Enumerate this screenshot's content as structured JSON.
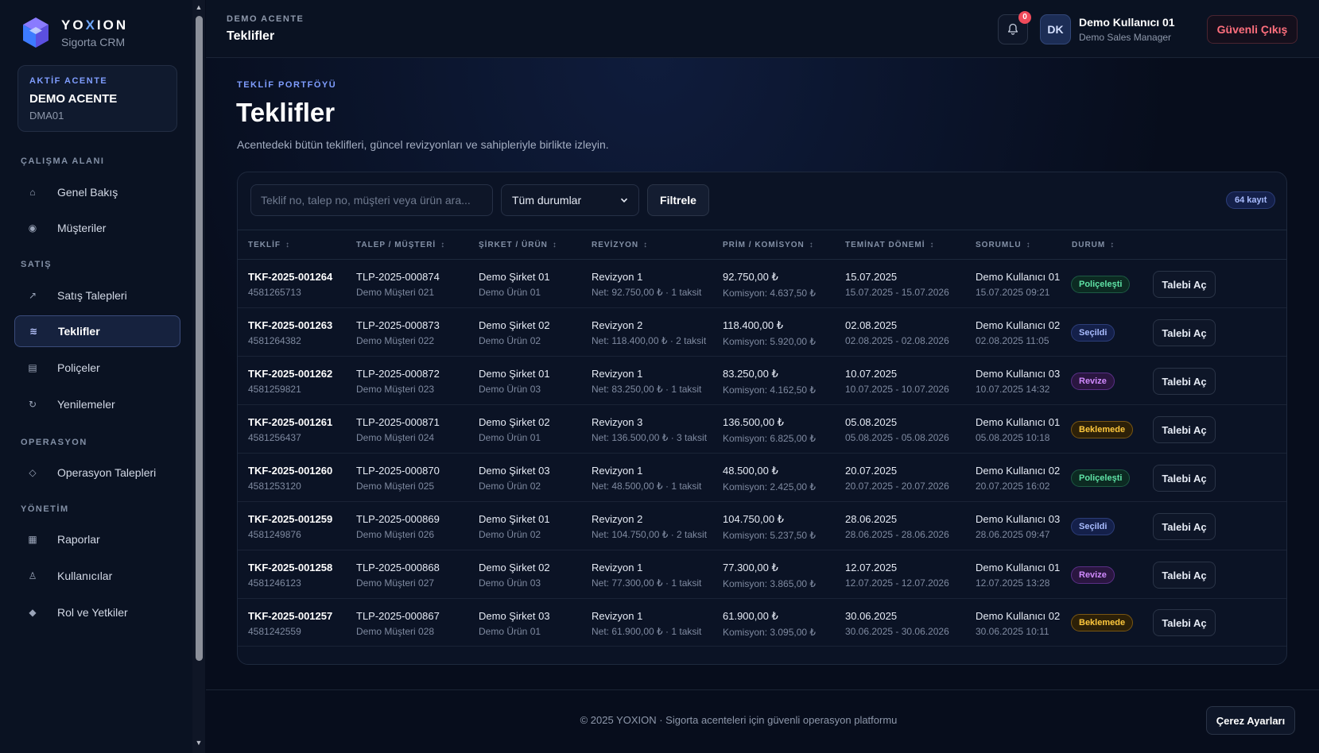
{
  "brand": {
    "name_pre": "YO",
    "name_x": "X",
    "name_post": "ION",
    "subtitle": "Sigorta CRM"
  },
  "agency": {
    "kicker": "AKTİF ACENTE",
    "name": "DEMO ACENTE",
    "code": "DMA01"
  },
  "nav": {
    "section_workspace": "ÇALIŞMA ALANI",
    "section_sales": "SATIŞ",
    "section_operations": "OPERASYON",
    "section_management": "YÖNETİM",
    "items": [
      {
        "label": "Genel Bakış",
        "icon": "home-icon"
      },
      {
        "label": "Müşteriler",
        "icon": "users-icon"
      },
      {
        "label": "Satış Talepleri",
        "icon": "trend-arrow-icon"
      },
      {
        "label": "Teklifler",
        "icon": "offers-icon"
      },
      {
        "label": "Poliçeler",
        "icon": "document-icon"
      },
      {
        "label": "Yenilemeler",
        "icon": "refresh-icon"
      },
      {
        "label": "Operasyon Talepleri",
        "icon": "diamond-icon"
      },
      {
        "label": "Raporlar",
        "icon": "report-icon"
      },
      {
        "label": "Kullanıcılar",
        "icon": "user-icon"
      },
      {
        "label": "Rol ve Yetkiler",
        "icon": "shield-icon"
      }
    ]
  },
  "topbar": {
    "kicker": "DEMO ACENTE",
    "title": "Teklifler",
    "notification_count": "0",
    "avatar_initials": "DK",
    "user_name": "Demo Kullanıcı 01",
    "user_role": "Demo Sales Manager",
    "logout_label": "Güvenli Çıkış"
  },
  "page": {
    "kicker": "TEKLİF PORTFÖYÜ",
    "title": "Teklifler",
    "description": "Acentedeki bütün teklifleri, güncel revizyonları ve sahipleriyle birlikte izleyin."
  },
  "filters": {
    "search_placeholder": "Teklif no, talep no, müşteri veya ürün ara...",
    "status_selected": "Tüm durumlar",
    "filter_label": "Filtrele",
    "record_count": "64 kayıt"
  },
  "table": {
    "headers": [
      "TEKLİF",
      "TALEP / MÜŞTERİ",
      "ŞİRKET / ÜRÜN",
      "REVİZYON",
      "PRİM / KOMİSYON",
      "TEMİNAT DÖNEMİ",
      "SORUMLU",
      "DURUM"
    ],
    "action_label": "Talebi Aç",
    "rows": [
      {
        "offer": "TKF-2025-001264",
        "offer_sub": "4581265713",
        "request": "TLP-2025-000874",
        "customer": "Demo Müşteri 021",
        "company": "Demo Şirket 01",
        "product": "Demo Ürün 01",
        "revision": "Revizyon 1",
        "revision_sub": "Net: 92.750,00 ₺ · 1 taksit",
        "premium": "92.750,00 ₺",
        "commission": "Komisyon: 4.637,50 ₺",
        "coverage_start": "15.07.2025",
        "coverage_range": "15.07.2025 - 15.07.2026",
        "owner": "Demo Kullanıcı 01",
        "owner_date": "15.07.2025 09:21",
        "status": "Poliçeleşti",
        "status_color": "green"
      },
      {
        "offer": "TKF-2025-001263",
        "offer_sub": "4581264382",
        "request": "TLP-2025-000873",
        "customer": "Demo Müşteri 022",
        "company": "Demo Şirket 02",
        "product": "Demo Ürün 02",
        "revision": "Revizyon 2",
        "revision_sub": "Net: 118.400,00 ₺ · 2 taksit",
        "premium": "118.400,00 ₺",
        "commission": "Komisyon: 5.920,00 ₺",
        "coverage_start": "02.08.2025",
        "coverage_range": "02.08.2025 - 02.08.2026",
        "owner": "Demo Kullanıcı 02",
        "owner_date": "02.08.2025 11:05",
        "status": "Seçildi",
        "status_color": "blue"
      },
      {
        "offer": "TKF-2025-001262",
        "offer_sub": "4581259821",
        "request": "TLP-2025-000872",
        "customer": "Demo Müşteri 023",
        "company": "Demo Şirket 01",
        "product": "Demo Ürün 03",
        "revision": "Revizyon 1",
        "revision_sub": "Net: 83.250,00 ₺ · 1 taksit",
        "premium": "83.250,00 ₺",
        "commission": "Komisyon: 4.162,50 ₺",
        "coverage_start": "10.07.2025",
        "coverage_range": "10.07.2025 - 10.07.2026",
        "owner": "Demo Kullanıcı 03",
        "owner_date": "10.07.2025 14:32",
        "status": "Revize",
        "status_color": "purple"
      },
      {
        "offer": "TKF-2025-001261",
        "offer_sub": "4581256437",
        "request": "TLP-2025-000871",
        "customer": "Demo Müşteri 024",
        "company": "Demo Şirket 02",
        "product": "Demo Ürün 01",
        "revision": "Revizyon 3",
        "revision_sub": "Net: 136.500,00 ₺ · 3 taksit",
        "premium": "136.500,00 ₺",
        "commission": "Komisyon: 6.825,00 ₺",
        "coverage_start": "05.08.2025",
        "coverage_range": "05.08.2025 - 05.08.2026",
        "owner": "Demo Kullanıcı 01",
        "owner_date": "05.08.2025 10:18",
        "status": "Beklemede",
        "status_color": "amber"
      },
      {
        "offer": "TKF-2025-001260",
        "offer_sub": "4581253120",
        "request": "TLP-2025-000870",
        "customer": "Demo Müşteri 025",
        "company": "Demo Şirket 03",
        "product": "Demo Ürün 02",
        "revision": "Revizyon 1",
        "revision_sub": "Net: 48.500,00 ₺ · 1 taksit",
        "premium": "48.500,00 ₺",
        "commission": "Komisyon: 2.425,00 ₺",
        "coverage_start": "20.07.2025",
        "coverage_range": "20.07.2025 - 20.07.2026",
        "owner": "Demo Kullanıcı 02",
        "owner_date": "20.07.2025 16:02",
        "status": "Poliçeleşti",
        "status_color": "green"
      },
      {
        "offer": "TKF-2025-001259",
        "offer_sub": "4581249876",
        "request": "TLP-2025-000869",
        "customer": "Demo Müşteri 026",
        "company": "Demo Şirket 01",
        "product": "Demo Ürün 02",
        "revision": "Revizyon 2",
        "revision_sub": "Net: 104.750,00 ₺ · 2 taksit",
        "premium": "104.750,00 ₺",
        "commission": "Komisyon: 5.237,50 ₺",
        "coverage_start": "28.06.2025",
        "coverage_range": "28.06.2025 - 28.06.2026",
        "owner": "Demo Kullanıcı 03",
        "owner_date": "28.06.2025 09:47",
        "status": "Seçildi",
        "status_color": "blue"
      },
      {
        "offer": "TKF-2025-001258",
        "offer_sub": "4581246123",
        "request": "TLP-2025-000868",
        "customer": "Demo Müşteri 027",
        "company": "Demo Şirket 02",
        "product": "Demo Ürün 03",
        "revision": "Revizyon 1",
        "revision_sub": "Net: 77.300,00 ₺ · 1 taksit",
        "premium": "77.300,00 ₺",
        "commission": "Komisyon: 3.865,00 ₺",
        "coverage_start": "12.07.2025",
        "coverage_range": "12.07.2025 - 12.07.2026",
        "owner": "Demo Kullanıcı 01",
        "owner_date": "12.07.2025 13:28",
        "status": "Revize",
        "status_color": "purple"
      },
      {
        "offer": "TKF-2025-001257",
        "offer_sub": "4581242559",
        "request": "TLP-2025-000867",
        "customer": "Demo Müşteri 028",
        "company": "Demo Şirket 03",
        "product": "Demo Ürün 01",
        "revision": "Revizyon 1",
        "revision_sub": "Net: 61.900,00 ₺ · 1 taksit",
        "premium": "61.900,00 ₺",
        "commission": "Komisyon: 3.095,00 ₺",
        "coverage_start": "30.06.2025",
        "coverage_range": "30.06.2025 - 30.06.2026",
        "owner": "Demo Kullanıcı 02",
        "owner_date": "30.06.2025 10:11",
        "status": "Beklemede",
        "status_color": "amber"
      }
    ]
  },
  "footer": {
    "text": "© 2025 YOXION · Sigorta acenteleri için güvenli operasyon platformu",
    "cookie_label": "Çerez Ayarları"
  },
  "colors": {
    "accent": "#7f9dff",
    "danger": "#ff6f7d",
    "background": "#070d1c"
  }
}
